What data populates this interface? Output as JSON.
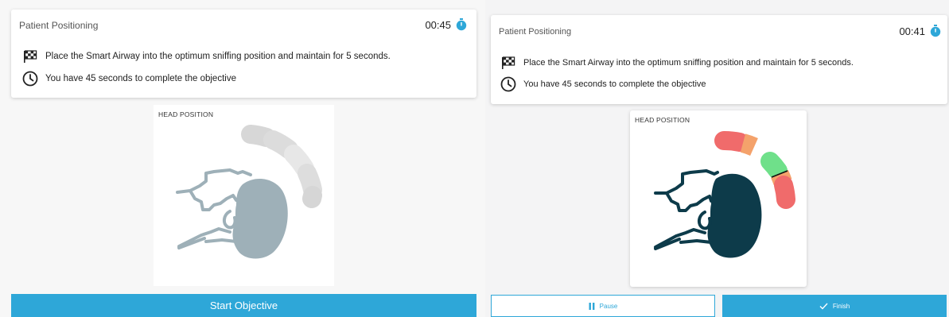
{
  "screens": [
    {
      "title": "Patient Positioning",
      "timer": "00:45",
      "objective": "Place the Smart Airway into the optimum sniffing position and maintain for 5 seconds.",
      "time_limit": "You have 45 seconds to complete the objective",
      "head_label": "HEAD POSITION",
      "start_label": "Start Objective"
    },
    {
      "title": "Patient Positioning",
      "timer": "00:41",
      "objective": "Place the Smart Airway into the optimum sniffing position and maintain for 5 seconds.",
      "time_limit": "You have 45 seconds to complete the objective",
      "head_label": "HEAD POSITION",
      "pause_label": "Pause",
      "finish_label": "Finish"
    }
  ],
  "colors": {
    "accent": "#2ea7d8",
    "head_inactive": "#9eb0b8",
    "head_active": "#0d3b4a",
    "zone_red": "#f06b6b",
    "zone_orange": "#f4a26b",
    "zone_green": "#6fe08a"
  },
  "icons": [
    "checkered-flag-icon",
    "clock-icon",
    "stopwatch-icon",
    "pause-icon",
    "check-icon"
  ]
}
